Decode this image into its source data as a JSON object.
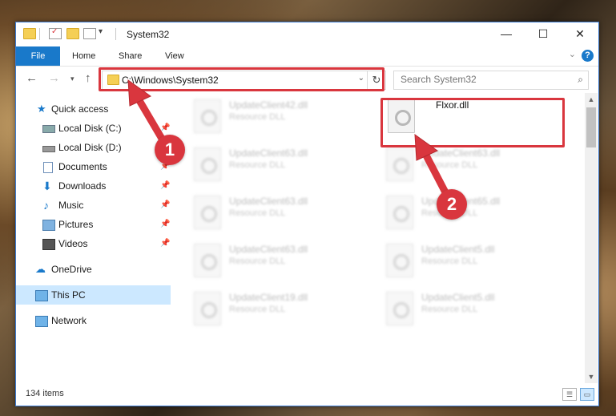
{
  "window": {
    "title": "System32",
    "controls": {
      "minimize": "—",
      "maximize": "☐",
      "close": "✕"
    }
  },
  "ribbon": {
    "tabs": [
      "File",
      "Home",
      "Share",
      "View"
    ],
    "help": "?"
  },
  "navigation": {
    "address": "C:\\Windows\\System32",
    "search_placeholder": "Search System32"
  },
  "sidebar": {
    "items": [
      {
        "label": "Quick access",
        "icon": "star-icon",
        "pinned": false
      },
      {
        "label": "Local Disk (C:)",
        "icon": "drive-icon",
        "pinned": true
      },
      {
        "label": "Local Disk (D:)",
        "icon": "drive-icon",
        "pinned": true
      },
      {
        "label": "Documents",
        "icon": "documents-icon",
        "pinned": true
      },
      {
        "label": "Downloads",
        "icon": "downloads-icon",
        "pinned": true
      },
      {
        "label": "Music",
        "icon": "music-icon",
        "pinned": true
      },
      {
        "label": "Pictures",
        "icon": "pictures-icon",
        "pinned": true
      },
      {
        "label": "Videos",
        "icon": "videos-icon",
        "pinned": true
      },
      {
        "label": "OneDrive",
        "icon": "cloud-icon",
        "pinned": false
      },
      {
        "label": "This PC",
        "icon": "computer-icon",
        "pinned": false,
        "selected": true
      },
      {
        "label": "Network",
        "icon": "network-icon",
        "pinned": false
      }
    ]
  },
  "files": [
    {
      "name": "UpdateClient42.dll",
      "type": "Resource DLL"
    },
    {
      "name": "Flxor.dll",
      "type": "",
      "highlighted": true
    },
    {
      "name": "UpdateClient63.dll",
      "type": "Resource DLL"
    },
    {
      "name": "UpdateClient63.dll",
      "type": "Resource DLL"
    },
    {
      "name": "UpdateClient63.dll",
      "type": "Resource DLL"
    },
    {
      "name": "UpdateClient65.dll",
      "type": "Resource DLL"
    },
    {
      "name": "UpdateClient63.dll",
      "type": "Resource DLL"
    },
    {
      "name": "UpdateClient5.dll",
      "type": "Resource DLL"
    },
    {
      "name": "UpdateClient19.dll",
      "type": "Resource DLL"
    },
    {
      "name": "UpdateClient5.dll",
      "type": "Resource DLL"
    }
  ],
  "status": {
    "item_count": "134 items"
  },
  "annotations": {
    "step1": "1",
    "step2": "2",
    "color": "#d9363e"
  }
}
